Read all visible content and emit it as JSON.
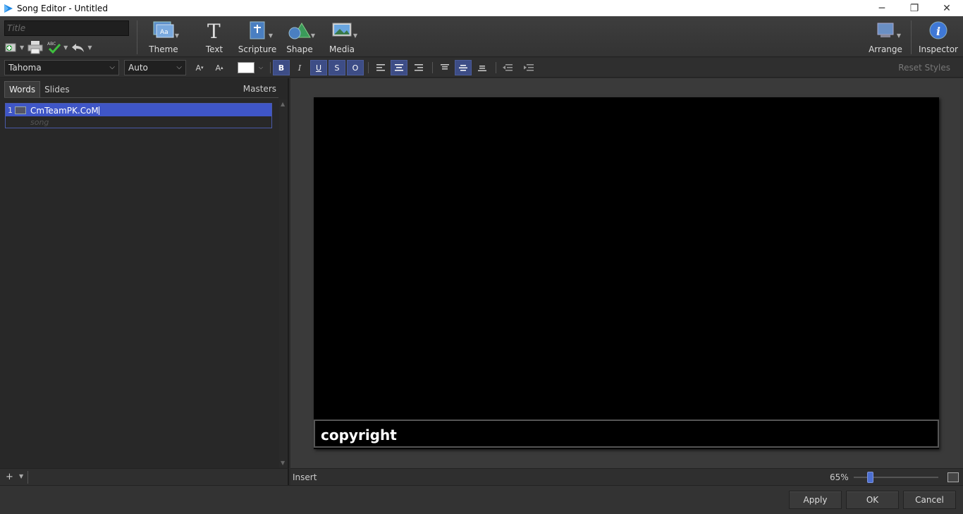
{
  "window": {
    "title": "Song Editor - Untitled",
    "minimize_glyph": "─",
    "maximize_glyph": "❐",
    "close_glyph": "✕"
  },
  "toolbar": {
    "title_placeholder": "Title",
    "title_value": "",
    "theme_label": "Theme",
    "text_label": "Text",
    "scripture_label": "Scripture",
    "shape_label": "Shape",
    "media_label": "Media",
    "arrange_label": "Arrange",
    "inspector_label": "Inspector"
  },
  "format": {
    "font": "Tahoma",
    "size": "Auto",
    "decrease_label": "A",
    "increase_label": "A",
    "bold": "B",
    "italic": "I",
    "underline": "U",
    "strike": "S",
    "outline": "O",
    "reset_styles": "Reset Styles",
    "text_color": "#ffffff",
    "accent": "#3d4d86"
  },
  "left_pane": {
    "tabs": [
      {
        "label": "Words",
        "active": true
      },
      {
        "label": "Slides",
        "active": false
      }
    ],
    "masters_label": "Masters",
    "slides": [
      {
        "number": "1",
        "text": "CmTeamPK.CoM",
        "group": "song"
      }
    ],
    "add_glyph": "+"
  },
  "canvas": {
    "background": "#000000",
    "copyright_text": "copyright"
  },
  "status": {
    "mode": "Insert",
    "zoom": "65%",
    "zoom_level_percent": 65
  },
  "footer": {
    "apply_label": "Apply",
    "ok_label": "OK",
    "cancel_label": "Cancel"
  }
}
